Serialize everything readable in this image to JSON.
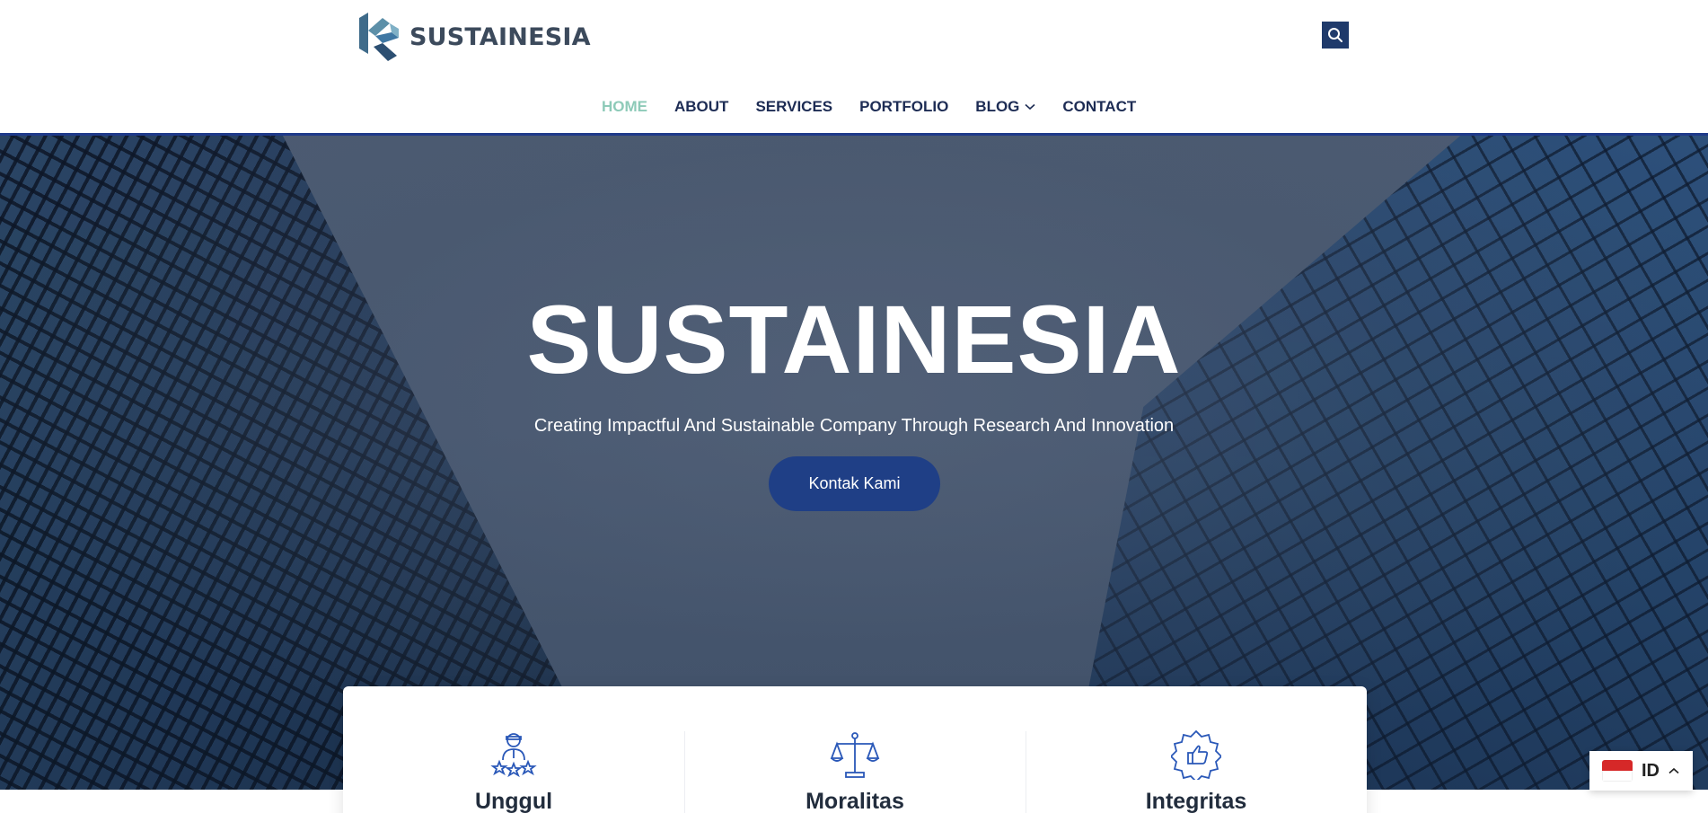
{
  "brand": {
    "name": "SUSTAINESIA",
    "accent": "#1f3f86",
    "active_nav_color": "#8dcab8"
  },
  "header": {
    "search_icon": "search-icon",
    "nav": [
      {
        "label": "HOME",
        "active": true
      },
      {
        "label": "ABOUT",
        "active": false
      },
      {
        "label": "SERVICES",
        "active": false
      },
      {
        "label": "PORTFOLIO",
        "active": false
      },
      {
        "label": "BLOG",
        "active": false,
        "dropdown": true
      },
      {
        "label": "CONTACT",
        "active": false
      }
    ]
  },
  "hero": {
    "title": "SUSTAINESIA",
    "subtitle": "Creating Impactful And Sustainable Company Through Research And Innovation",
    "cta_label": "Kontak Kami"
  },
  "features": [
    {
      "title": "Unggul",
      "icon": "team-stars-icon"
    },
    {
      "title": "Moralitas",
      "icon": "balance-scale-icon"
    },
    {
      "title": "Integritas",
      "icon": "thumbs-up-badge-icon"
    }
  ],
  "language": {
    "code": "ID",
    "flag": "indonesia-flag-icon"
  }
}
